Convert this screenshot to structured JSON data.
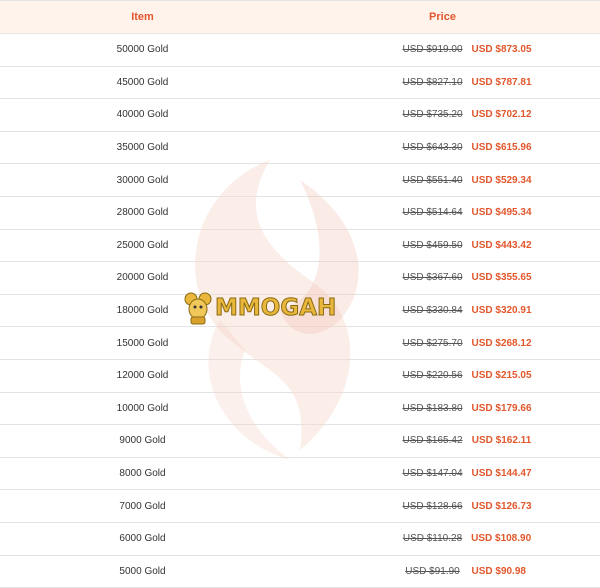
{
  "header": {
    "item_label": "Item",
    "price_label": "Price"
  },
  "rows": [
    {
      "item": "50000 Gold",
      "old_price": "USD $919.00",
      "new_price": "USD $873.05"
    },
    {
      "item": "45000 Gold",
      "old_price": "USD $827.10",
      "new_price": "USD $787.81"
    },
    {
      "item": "40000 Gold",
      "old_price": "USD $735.20",
      "new_price": "USD $702.12"
    },
    {
      "item": "35000 Gold",
      "old_price": "USD $643.30",
      "new_price": "USD $615.96"
    },
    {
      "item": "30000 Gold",
      "old_price": "USD $551.40",
      "new_price": "USD $529.34"
    },
    {
      "item": "28000 Gold",
      "old_price": "USD $514.64",
      "new_price": "USD $495.34"
    },
    {
      "item": "25000 Gold",
      "old_price": "USD $459.50",
      "new_price": "USD $443.42"
    },
    {
      "item": "20000 Gold",
      "old_price": "USD $367.60",
      "new_price": "USD $355.65"
    },
    {
      "item": "18000 Gold",
      "old_price": "USD $330.84",
      "new_price": "USD $320.91"
    },
    {
      "item": "15000 Gold",
      "old_price": "USD $275.70",
      "new_price": "USD $268.12"
    },
    {
      "item": "12000 Gold",
      "old_price": "USD $220.56",
      "new_price": "USD $215.05"
    },
    {
      "item": "10000 Gold",
      "old_price": "USD $183.80",
      "new_price": "USD $179.66"
    },
    {
      "item": "9000 Gold",
      "old_price": "USD $165.42",
      "new_price": "USD $162.11"
    },
    {
      "item": "8000 Gold",
      "old_price": "USD $147.04",
      "new_price": "USD $144.47"
    },
    {
      "item": "7000 Gold",
      "old_price": "USD $128.66",
      "new_price": "USD $126.73"
    },
    {
      "item": "6000 Gold",
      "old_price": "USD $110.28",
      "new_price": "USD $108.90"
    },
    {
      "item": "5000 Gold",
      "old_price": "USD $91.90",
      "new_price": "USD $90.98"
    }
  ],
  "watermark": {
    "logo_text": "MMOGAH"
  },
  "colors": {
    "accent": "#e2572c",
    "header_bg": "#fff3ec",
    "logo_gold": "#e8b73c"
  }
}
